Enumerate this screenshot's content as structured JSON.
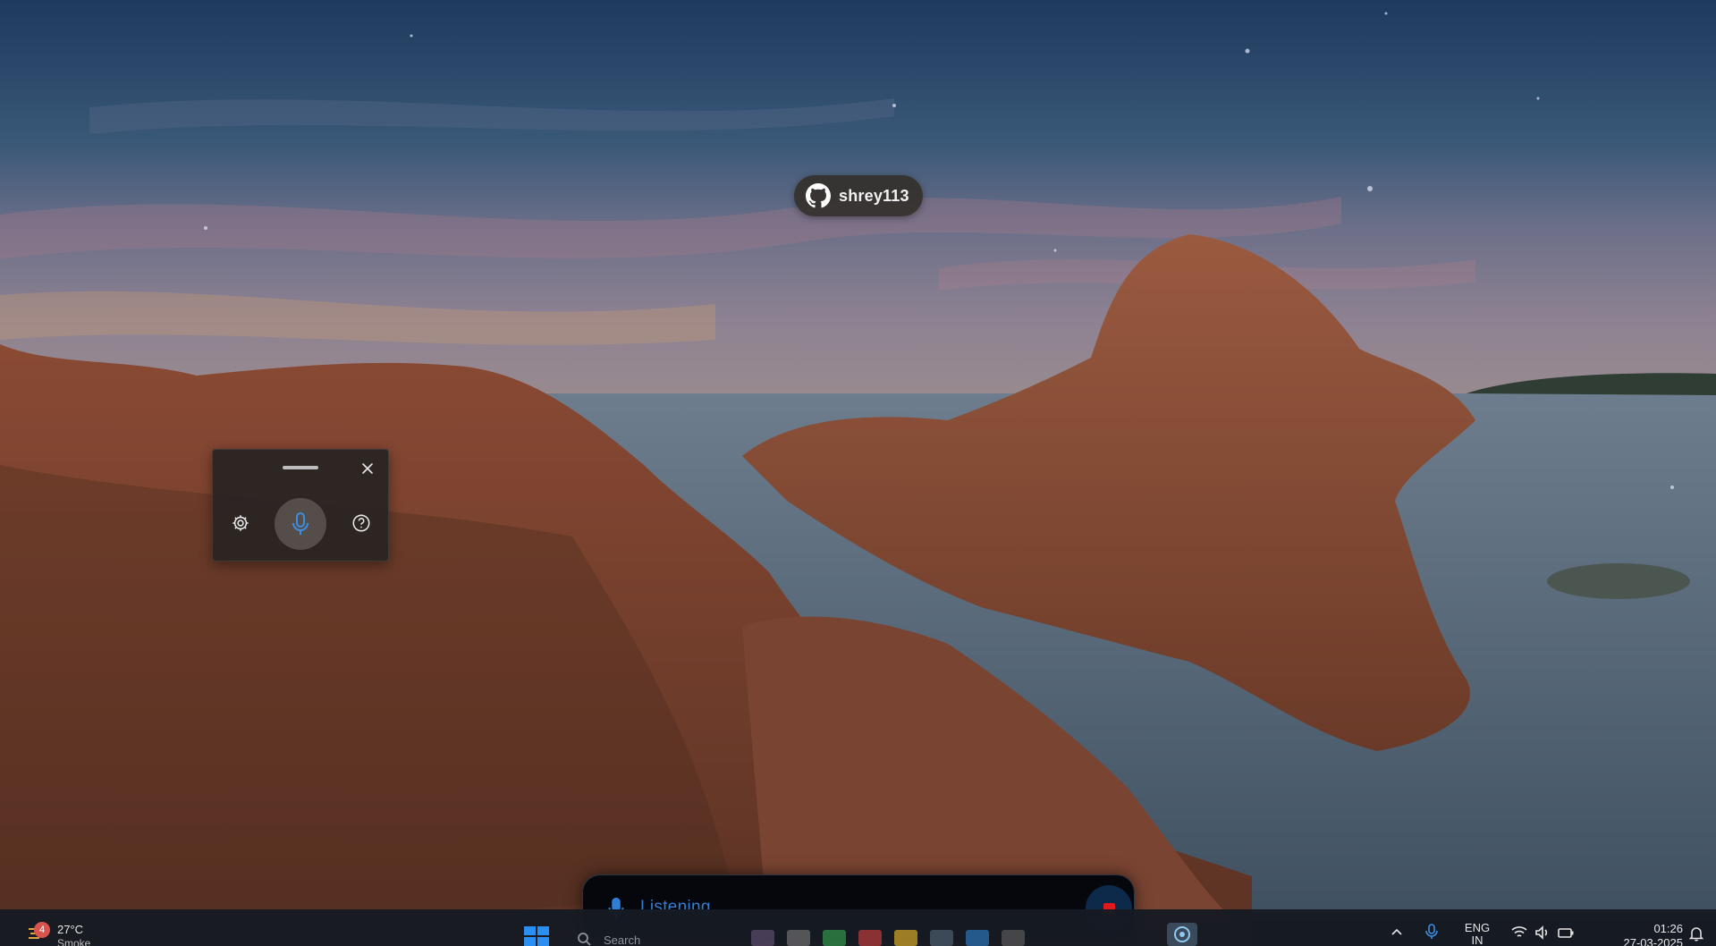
{
  "github_badge": {
    "username": "shrey113"
  },
  "voice_widget": {
    "close_label": "✕"
  },
  "listening_bar": {
    "status_text": "Listening..."
  },
  "taskbar": {
    "weather": {
      "badge_count": "4",
      "temperature": "27°C",
      "condition": "Smoke"
    },
    "search_label": "Search",
    "tray": {
      "language_line1": "ENG",
      "language_line2": "IN",
      "time": "01:26",
      "date": "27-03-2025"
    }
  },
  "colors": {
    "listening_text": "#2f7fd6",
    "stop_icon": "#e0191d",
    "widget_bg": "#282422"
  }
}
